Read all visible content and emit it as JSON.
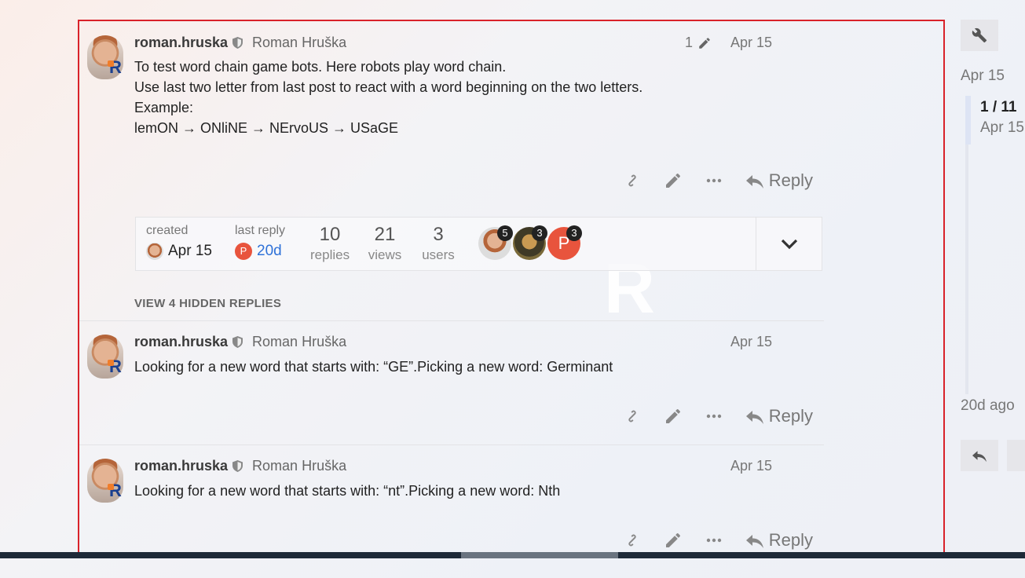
{
  "posts": [
    {
      "username": "roman.hruska",
      "full_name": "Roman Hruška",
      "date": "Apr 15",
      "edit_count": "1",
      "lines": [
        "To test word chain game bots. Here robots play word chain.",
        "Use last two letter from last post to react with a word beginning on the two letters.",
        "Example:",
        "lemON → ONliNE → NErvoUS → USaGE"
      ],
      "reply_label": "Reply"
    },
    {
      "username": "roman.hruska",
      "full_name": "Roman Hruška",
      "date": "Apr 15",
      "lines": [
        "Looking for a new word that starts with: “GE”.Picking a new word: Germinant"
      ],
      "reply_label": "Reply"
    },
    {
      "username": "roman.hruska",
      "full_name": "Roman Hruška",
      "date": "Apr 15",
      "lines": [
        "Looking for a new word that starts with: “nt”.Picking a new word: Nth"
      ],
      "reply_label": "Reply"
    }
  ],
  "topic_map": {
    "created_label": "created",
    "created_date": "Apr 15",
    "last_reply_label": "last reply",
    "last_reply_value": "20d",
    "last_reply_avatar_letter": "P",
    "replies": "10",
    "replies_label": "replies",
    "views": "21",
    "views_label": "views",
    "users": "3",
    "users_label": "users",
    "user_avatars": [
      {
        "count": "5"
      },
      {
        "count": "3"
      },
      {
        "letter": "P",
        "count": "3"
      }
    ]
  },
  "hidden_replies_label": "VIEW 4 HIDDEN REPLIES",
  "timeline": {
    "top_date": "Apr 15",
    "position": "1 / 11",
    "position_date": "Apr 15",
    "bottom_label": "20d ago"
  },
  "colors": {
    "frame_border": "#d9222a",
    "link": "#2f72d8",
    "avatar_p": "#e8543d"
  }
}
